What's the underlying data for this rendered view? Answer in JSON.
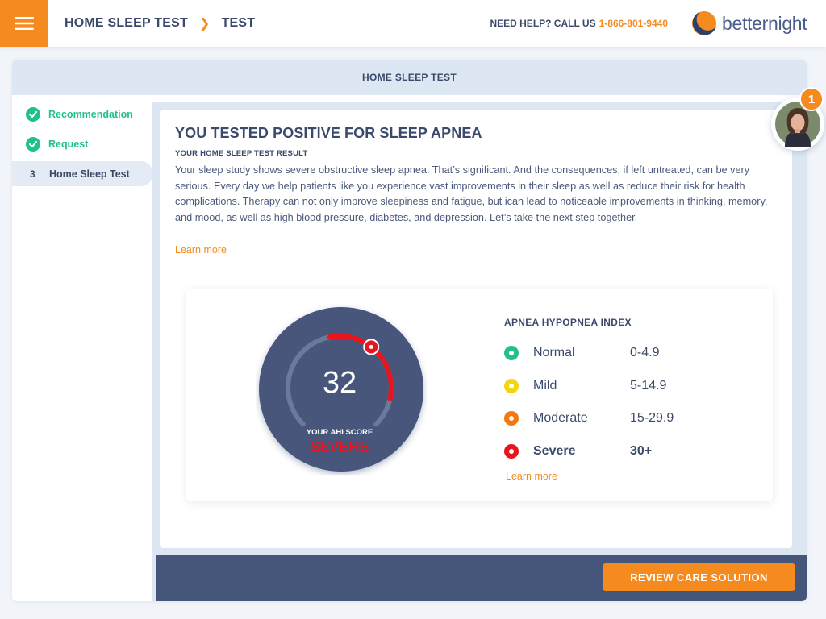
{
  "header": {
    "breadcrumb": [
      "HOME SLEEP TEST",
      "TEST"
    ],
    "help_label": "NEED HELP? CALL US",
    "phone": "1-866-801-9440",
    "logo_better": "better",
    "logo_night": "night",
    "menu_icon": "hamburger-icon"
  },
  "card": {
    "header_title": "HOME SLEEP TEST"
  },
  "steps": [
    {
      "label": "Recommendation",
      "status": "complete"
    },
    {
      "label": "Request",
      "status": "complete"
    },
    {
      "number": "3",
      "label": "Home Sleep Test",
      "status": "active"
    }
  ],
  "result": {
    "title": "YOU TESTED POSITIVE FOR SLEEP APNEA",
    "subtitle": "YOUR HOME SLEEP TEST RESULT",
    "paragraph": "Your sleep study shows severe obstructive sleep apnea. That’s significant. And the consequences, if left untreated, can be very serious. Every day we help patients like you experience vast improvements in their sleep as well as reduce their risk for health complications. Therapy can not only improve sleepiness and fatigue, but ican lead to noticeable improvements in thinking, memory, and mood, as well as high blood pressure, diabetes, and depression. Let’s take the next step together.",
    "learn_more": "Learn more"
  },
  "gauge": {
    "score": "32",
    "score_label": "YOUR AHI SCORE",
    "severity": "SEVERE",
    "fraction": 0.64
  },
  "index": {
    "title": "APNEA HYPOPNEA INDEX",
    "levels": [
      {
        "name": "Normal",
        "range": "0-4.9",
        "color": "#22c08a"
      },
      {
        "name": "Mild",
        "range": "5-14.9",
        "color": "#f5d50f"
      },
      {
        "name": "Moderate",
        "range": "15-29.9",
        "color": "#f5770f"
      },
      {
        "name": "Severe",
        "range": "30+",
        "color": "#e8141e"
      }
    ],
    "learn_more": "Learn more"
  },
  "footer": {
    "button_label": "REVIEW CARE SOLUTION"
  },
  "notification": {
    "count": "1"
  },
  "colors": {
    "accent": "#f58a1f",
    "navy": "#46567a",
    "success": "#22c08a",
    "severe": "#e8141e"
  }
}
